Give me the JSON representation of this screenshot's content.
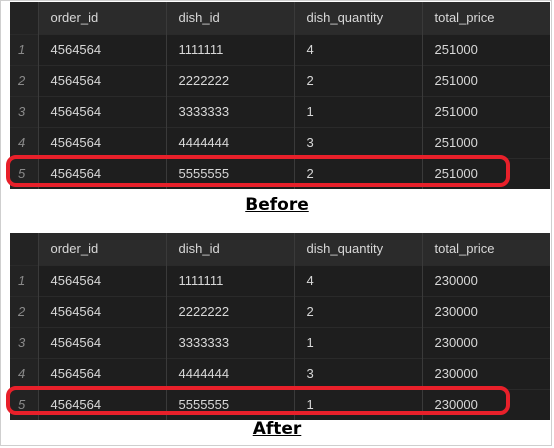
{
  "columns": [
    "order_id",
    "dish_id",
    "dish_quantity",
    "total_price"
  ],
  "before": {
    "caption": "Before",
    "rows": [
      {
        "num": "1",
        "order_id": "4564564",
        "dish_id": "1111111",
        "dish_quantity": "4",
        "total_price": "251000"
      },
      {
        "num": "2",
        "order_id": "4564564",
        "dish_id": "2222222",
        "dish_quantity": "2",
        "total_price": "251000"
      },
      {
        "num": "3",
        "order_id": "4564564",
        "dish_id": "3333333",
        "dish_quantity": "1",
        "total_price": "251000"
      },
      {
        "num": "4",
        "order_id": "4564564",
        "dish_id": "4444444",
        "dish_quantity": "3",
        "total_price": "251000"
      },
      {
        "num": "5",
        "order_id": "4564564",
        "dish_id": "5555555",
        "dish_quantity": "2",
        "total_price": "251000"
      }
    ]
  },
  "after": {
    "caption": "After",
    "rows": [
      {
        "num": "1",
        "order_id": "4564564",
        "dish_id": "1111111",
        "dish_quantity": "4",
        "total_price": "230000"
      },
      {
        "num": "2",
        "order_id": "4564564",
        "dish_id": "2222222",
        "dish_quantity": "2",
        "total_price": "230000"
      },
      {
        "num": "3",
        "order_id": "4564564",
        "dish_id": "3333333",
        "dish_quantity": "1",
        "total_price": "230000"
      },
      {
        "num": "4",
        "order_id": "4564564",
        "dish_id": "4444444",
        "dish_quantity": "3",
        "total_price": "230000"
      },
      {
        "num": "5",
        "order_id": "4564564",
        "dish_id": "5555555",
        "dish_quantity": "1",
        "total_price": "230000"
      }
    ]
  },
  "colors": {
    "highlight": "#e8202a",
    "grid_bg": "#1e1e1e",
    "header_bg": "#2b2b2b"
  }
}
